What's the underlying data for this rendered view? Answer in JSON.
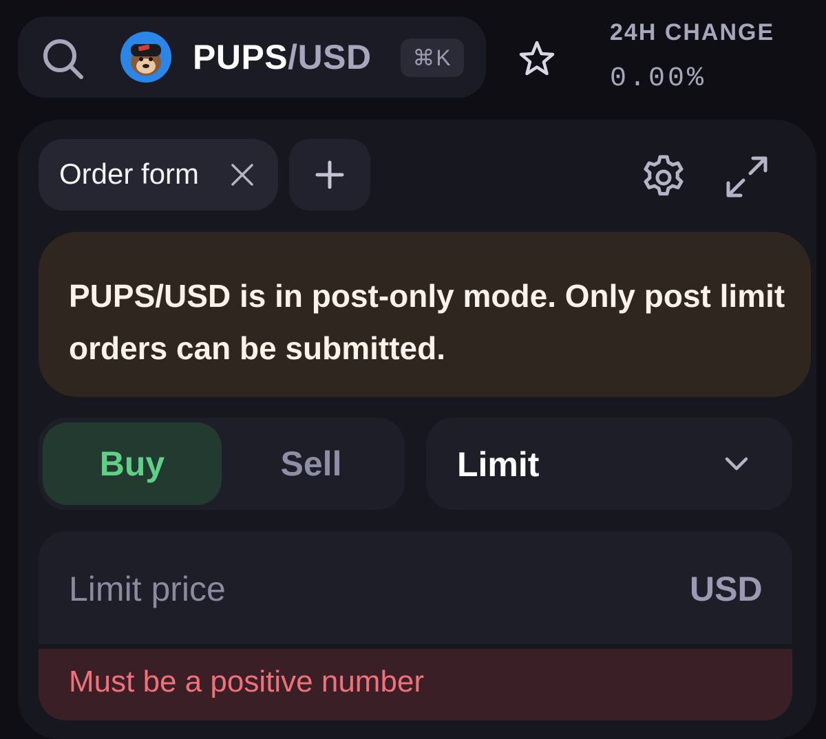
{
  "header": {
    "pair_base": "PUPS",
    "pair_separator": "/",
    "pair_quote": "USD",
    "shortcut": "⌘K",
    "change_label": "24H CHANGE",
    "change_value": "0.00%",
    "icons": [
      "search-icon",
      "pair-logo",
      "star-icon"
    ]
  },
  "tabs": {
    "active_label": "Order form",
    "icons": [
      "close-icon",
      "plus-icon",
      "gear-icon",
      "expand-icon"
    ]
  },
  "warning": {
    "text": "PUPS/USD is in post-only mode. Only post limit orders can be submitted.",
    "background": "#2f261f"
  },
  "order": {
    "side_buy": "Buy",
    "side_sell": "Sell",
    "selected_side": "Buy",
    "order_type": "Limit",
    "limit_price_placeholder": "Limit price",
    "limit_price_unit": "USD",
    "error": "Must be a positive number"
  },
  "colors": {
    "buy": "#5fd187",
    "buy_bg": "#233a30",
    "error": "#f0717a",
    "error_bg": "#3a1f27"
  }
}
